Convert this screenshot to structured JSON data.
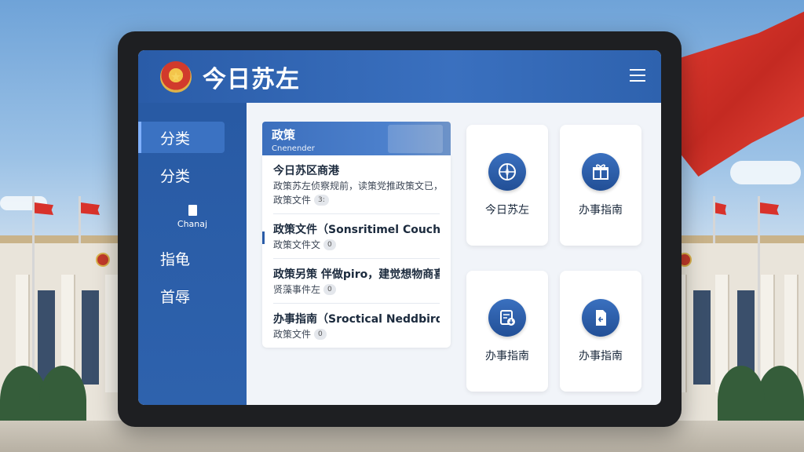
{
  "app": {
    "title": "今日苏左"
  },
  "sidebar": {
    "items": [
      {
        "label": "分类",
        "active": true
      },
      {
        "label": "分类"
      },
      {
        "label": "Chanaj",
        "icon": "document-icon"
      },
      {
        "label": "指龟"
      },
      {
        "label": "首辱"
      }
    ]
  },
  "policy": {
    "title": "政策",
    "subtitle": "Cnenender"
  },
  "news": [
    {
      "title": "今日苏区商港",
      "desc": "政策苏左侦察规前，读策党推政策文已，",
      "meta": "政策文件",
      "tag": "3:"
    },
    {
      "title": "政策文件（Sonsritimel Couchures: 大篇",
      "meta": "政策文件文",
      "tag": "0"
    },
    {
      "title": "政策另策 伴做piro，建觉想物商喜，",
      "meta": "贤藻事件左",
      "tag": "0"
    },
    {
      "title": "办事指南（Sroctical Neddbird Brweo...",
      "meta": "政策文件",
      "tag": "0"
    }
  ],
  "tiles": [
    {
      "label": "今日苏左",
      "icon": "compass-icon"
    },
    {
      "label": "办事指南",
      "icon": "gift-icon"
    },
    {
      "label": "办事指南",
      "icon": "form-download-icon"
    },
    {
      "label": "办事指南",
      "icon": "document-return-icon"
    }
  ]
}
